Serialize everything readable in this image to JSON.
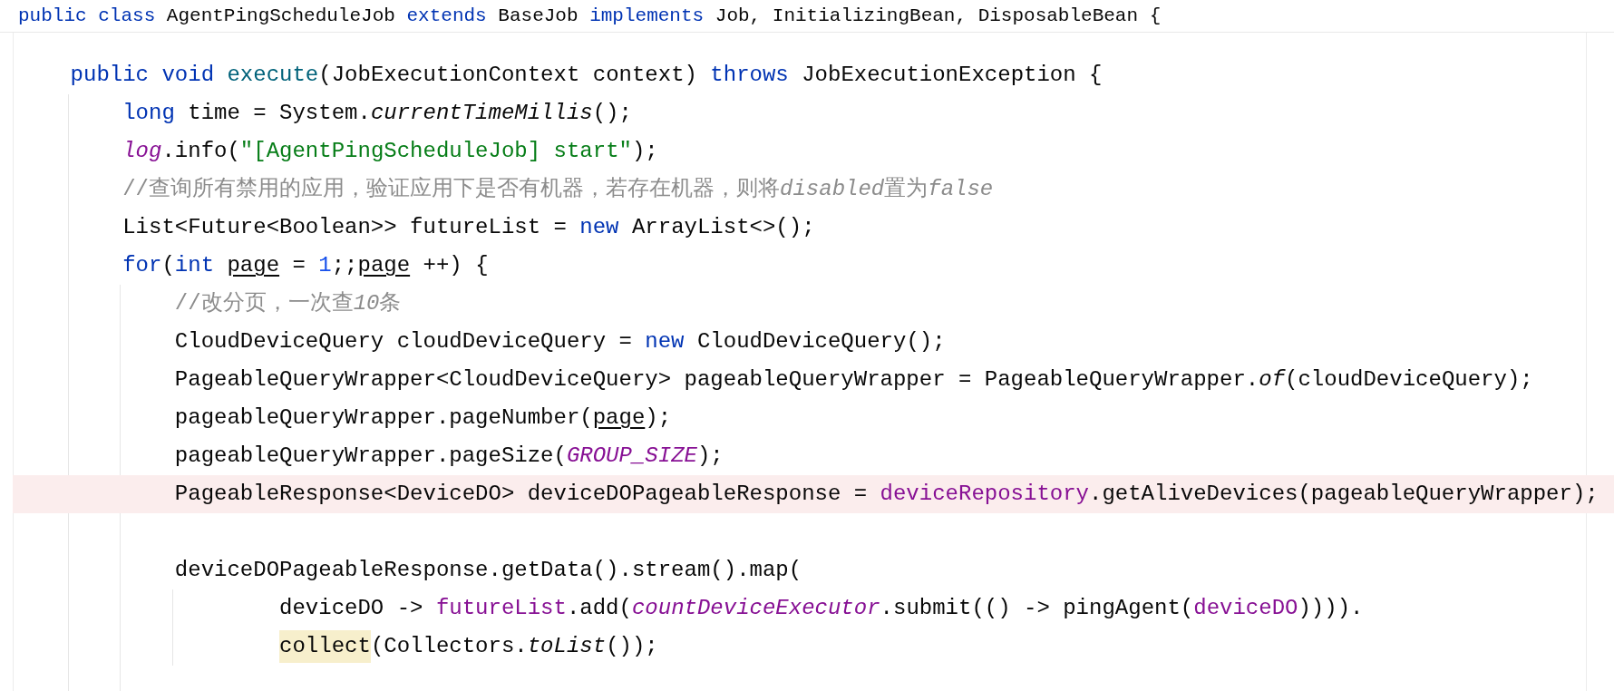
{
  "sticky_header": {
    "tokens": [
      {
        "text": "public ",
        "kind": "keyword"
      },
      {
        "text": "class",
        "kind": "keyword"
      },
      {
        "text": " AgentPingScheduleJob ",
        "kind": "plain"
      },
      {
        "text": "extends",
        "kind": "keyword"
      },
      {
        "text": " BaseJob ",
        "kind": "plain"
      },
      {
        "text": "implements",
        "kind": "keyword"
      },
      {
        "text": " Job, InitializingBean, DisposableBean {",
        "kind": "plain"
      }
    ]
  },
  "lines": [
    {
      "highlighted": false
    },
    {
      "highlighted": false,
      "tokens": [
        {
          "text": "    public ",
          "kind": "keyword"
        },
        {
          "text": "void ",
          "kind": "keyword"
        },
        {
          "text": "execute",
          "kind": "method"
        },
        {
          "text": "(JobExecutionContext context) ",
          "kind": "plain"
        },
        {
          "text": "throws",
          "kind": "keyword"
        },
        {
          "text": " JobExecutionException {",
          "kind": "plain"
        }
      ]
    },
    {
      "highlighted": false,
      "tokens": [
        {
          "text": "        long",
          "kind": "keyword"
        },
        {
          "text": " time = System.",
          "kind": "plain"
        },
        {
          "text": "currentTimeMillis",
          "kind": "static_method"
        },
        {
          "text": "();",
          "kind": "plain"
        }
      ]
    },
    {
      "highlighted": false,
      "tokens": [
        {
          "text": "        log",
          "kind": "static_field"
        },
        {
          "text": ".info(",
          "kind": "plain"
        },
        {
          "text": "\"[AgentPingScheduleJob] start\"",
          "kind": "string"
        },
        {
          "text": ");",
          "kind": "plain"
        }
      ]
    },
    {
      "highlighted": false,
      "tokens": [
        {
          "text": "        //查询所有禁用的应用，验证应用下是否有机器，若存在机器，则将",
          "kind": "comment"
        },
        {
          "text": "disabled",
          "kind": "comment_italic"
        },
        {
          "text": "置为",
          "kind": "comment"
        },
        {
          "text": "false",
          "kind": "comment_italic"
        }
      ]
    },
    {
      "highlighted": false,
      "tokens": [
        {
          "text": "        List<Future<Boolean>> futureList = ",
          "kind": "plain"
        },
        {
          "text": "new",
          "kind": "keyword"
        },
        {
          "text": " ArrayList<>();",
          "kind": "plain"
        }
      ]
    },
    {
      "highlighted": false,
      "tokens": [
        {
          "text": "        for",
          "kind": "keyword"
        },
        {
          "text": "(",
          "kind": "plain"
        },
        {
          "text": "int ",
          "kind": "keyword"
        },
        {
          "text": "page",
          "kind": "mutable_var"
        },
        {
          "text": " = ",
          "kind": "plain"
        },
        {
          "text": "1",
          "kind": "number"
        },
        {
          "text": ";;",
          "kind": "plain"
        },
        {
          "text": "page",
          "kind": "mutable_var"
        },
        {
          "text": " ++) {",
          "kind": "plain"
        }
      ]
    },
    {
      "highlighted": false,
      "tokens": [
        {
          "text": "            //改分页，一次查",
          "kind": "comment"
        },
        {
          "text": "10",
          "kind": "comment_italic"
        },
        {
          "text": "条",
          "kind": "comment"
        }
      ]
    },
    {
      "highlighted": false,
      "tokens": [
        {
          "text": "            CloudDeviceQuery cloudDeviceQuery = ",
          "kind": "plain"
        },
        {
          "text": "new",
          "kind": "keyword"
        },
        {
          "text": " CloudDeviceQuery();",
          "kind": "plain"
        }
      ]
    },
    {
      "highlighted": false,
      "tokens": [
        {
          "text": "            PageableQueryWrapper<CloudDeviceQuery> pageableQueryWrapper = PageableQueryWrapper.",
          "kind": "plain"
        },
        {
          "text": "of",
          "kind": "static_method"
        },
        {
          "text": "(cloudDeviceQuery);",
          "kind": "plain"
        }
      ]
    },
    {
      "highlighted": false,
      "tokens": [
        {
          "text": "            pageableQueryWrapper.pageNumber(",
          "kind": "plain"
        },
        {
          "text": "page",
          "kind": "mutable_var"
        },
        {
          "text": ");",
          "kind": "plain"
        }
      ]
    },
    {
      "highlighted": false,
      "tokens": [
        {
          "text": "            pageableQueryWrapper.pageSize(",
          "kind": "plain"
        },
        {
          "text": "GROUP_SIZE",
          "kind": "static_field"
        },
        {
          "text": ");",
          "kind": "plain"
        }
      ]
    },
    {
      "highlighted": true,
      "tokens": [
        {
          "text": "            PageableResponse<DeviceDO> deviceDOPageableResponse = ",
          "kind": "plain"
        },
        {
          "text": "deviceRepository",
          "kind": "field"
        },
        {
          "text": ".getAliveDevices(pageableQueryWrapper);",
          "kind": "plain"
        }
      ]
    },
    {
      "highlighted": false
    },
    {
      "highlighted": false,
      "tokens": [
        {
          "text": "            deviceDOPageableResponse.getData().stream().map(",
          "kind": "plain"
        }
      ]
    },
    {
      "highlighted": false,
      "tokens": [
        {
          "text": "                    deviceDO -> ",
          "kind": "plain"
        },
        {
          "text": "futureList",
          "kind": "field"
        },
        {
          "text": ".add(",
          "kind": "plain"
        },
        {
          "text": "countDeviceExecutor",
          "kind": "static_field"
        },
        {
          "text": ".submit(() -> pingAgent(",
          "kind": "plain"
        },
        {
          "text": "deviceDO",
          "kind": "field"
        },
        {
          "text": ")))).",
          "kind": "plain"
        }
      ]
    },
    {
      "highlighted": false,
      "tokens": [
        {
          "text": "                    collect",
          "kind": "usage"
        },
        {
          "text": "(Collectors.",
          "kind": "plain"
        },
        {
          "text": "toList",
          "kind": "static_method"
        },
        {
          "text": "());",
          "kind": "plain"
        }
      ]
    }
  ]
}
